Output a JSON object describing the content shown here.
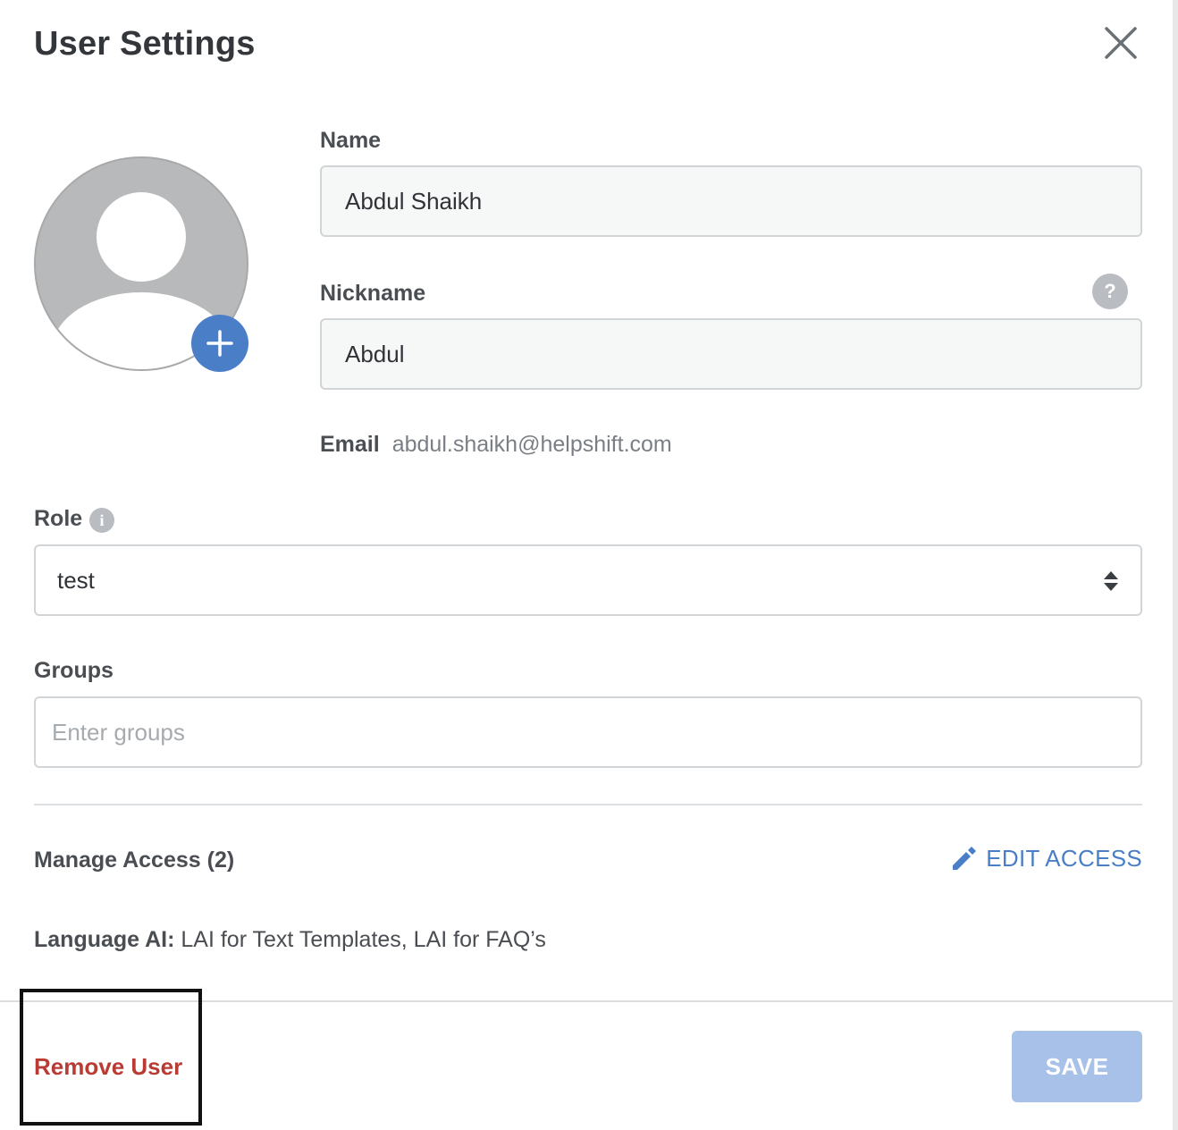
{
  "dialog": {
    "title": "User Settings"
  },
  "name_field": {
    "label": "Name",
    "value": "Abdul Shaikh"
  },
  "nickname_field": {
    "label": "Nickname",
    "value": "Abdul",
    "help_icon": "?"
  },
  "email": {
    "label": "Email",
    "value": "abdul.shaikh@helpshift.com"
  },
  "role": {
    "label": "Role",
    "info_icon": "i",
    "selected": "test"
  },
  "groups": {
    "label": "Groups",
    "placeholder": "Enter groups"
  },
  "access": {
    "manage_label": "Manage Access (2)",
    "edit_label": "EDIT ACCESS",
    "language_key": "Language AI:",
    "language_value": " LAI for Text Templates, LAI for FAQ’s"
  },
  "footer": {
    "remove_label": "Remove User",
    "save_label": "SAVE"
  },
  "colors": {
    "accent": "#4a7fc8",
    "danger": "#b93b34",
    "save_disabled": "#a7c1e8"
  },
  "icons": [
    "close-icon",
    "avatar-placeholder-icon",
    "plus-icon",
    "help-icon",
    "info-icon",
    "select-arrows-icon",
    "pencil-icon"
  ]
}
